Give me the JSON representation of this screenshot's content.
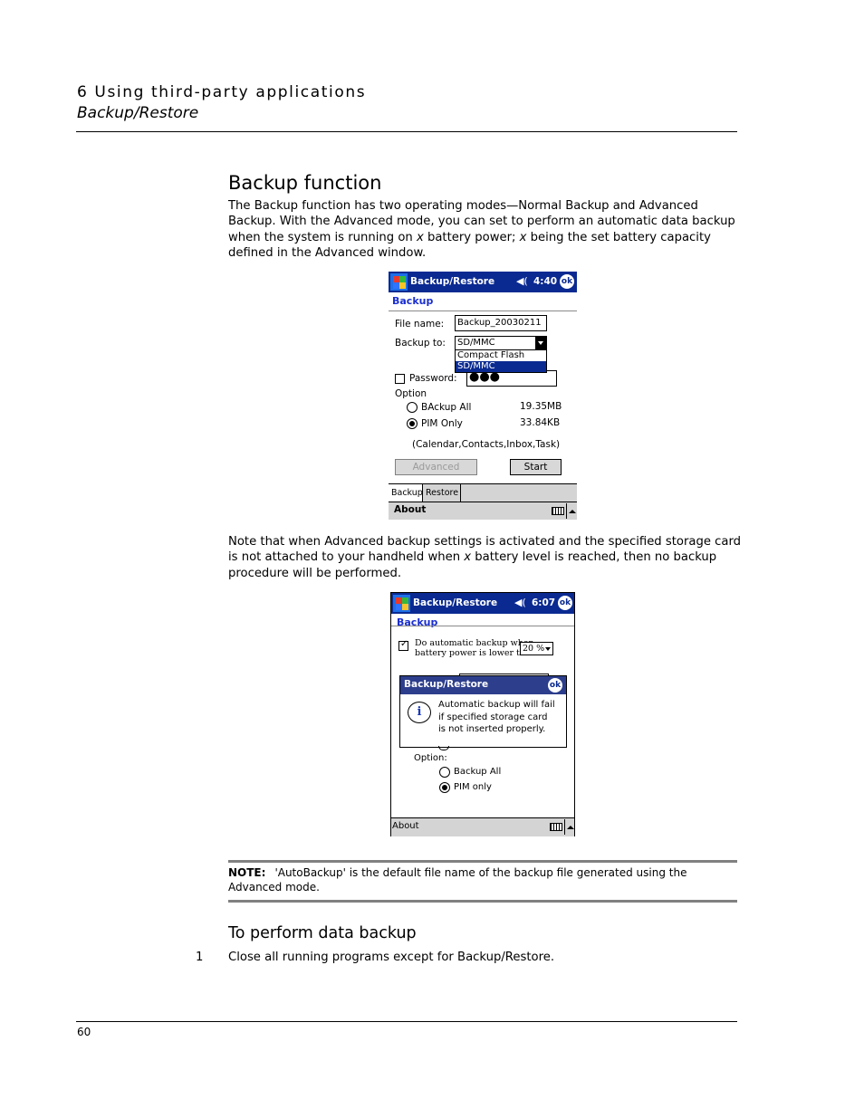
{
  "header": {
    "chapter": "6 Using third-party applications",
    "section": "Backup/Restore"
  },
  "sections": {
    "backup_function": {
      "heading": "Backup function",
      "paragraph": "The Backup function has two operating modes—Normal Backup and Advanced Backup. With the Advanced mode, you can set to perform an automatic data backup when the system is running on x battery power; x being the set battery capacity defined in the Advanced window."
    },
    "note_paragraph": "Note that when Advanced backup settings is activated and the specified storage card is not attached to your handheld when x battery level is reached, then no backup procedure will be performed.",
    "note_box": {
      "label": "NOTE:",
      "text": "'AutoBackup' is the default file name of the backup file generated using the Advanced mode."
    },
    "perform": {
      "heading": "To perform data backup",
      "steps": [
        {
          "number": "1",
          "text": "Close all running programs except for Backup/Restore."
        }
      ]
    }
  },
  "screen1": {
    "title": "Backup/Restore",
    "speaker_icon": "speaker-icon",
    "time": "4:40",
    "ok": "ok",
    "subheading": "Backup",
    "file_name_label": "File name:",
    "file_name_value": "Backup_20030211",
    "backup_to_label": "Backup to:",
    "backup_to_value": "SD/MMC",
    "dropdown_options": [
      "Compact Flash",
      "SD/MMC"
    ],
    "dropdown_selected": "SD/MMC",
    "password_label": "Password:",
    "password_checked": false,
    "password_value": "●●●",
    "option_label": "Option",
    "options": [
      {
        "label": "BAckup All",
        "size": "19.35MB",
        "selected": false
      },
      {
        "label": "PIM Only",
        "size": "33.84KB",
        "selected": true
      }
    ],
    "pim_note": "(Calendar,Contacts,Inbox,Task)",
    "advanced_button": "Advanced",
    "start_button": "Start",
    "tabs": [
      {
        "label": "Backup",
        "active": true
      },
      {
        "label": "Restore",
        "active": false
      }
    ],
    "menu_about": "About"
  },
  "screen2": {
    "title": "Backup/Restore",
    "time": "6:07",
    "ok": "ok",
    "subheading": "Backup",
    "auto_backup_checked": true,
    "auto_backup_line1": "Do automatic backup when",
    "auto_backup_line2": "battery power is lower than",
    "battery_threshold": "20 %",
    "dialog": {
      "title": "Backup/Restore",
      "ok": "ok",
      "message_lines": [
        "Automatic backup will fail",
        "if specified storage card",
        "is not inserted properly."
      ]
    },
    "option_label": "Option:",
    "options": [
      {
        "label": "Backup All",
        "selected": false
      },
      {
        "label": "PIM only",
        "selected": true
      }
    ],
    "menu_about": "About"
  },
  "footer": {
    "page_number": "60"
  }
}
